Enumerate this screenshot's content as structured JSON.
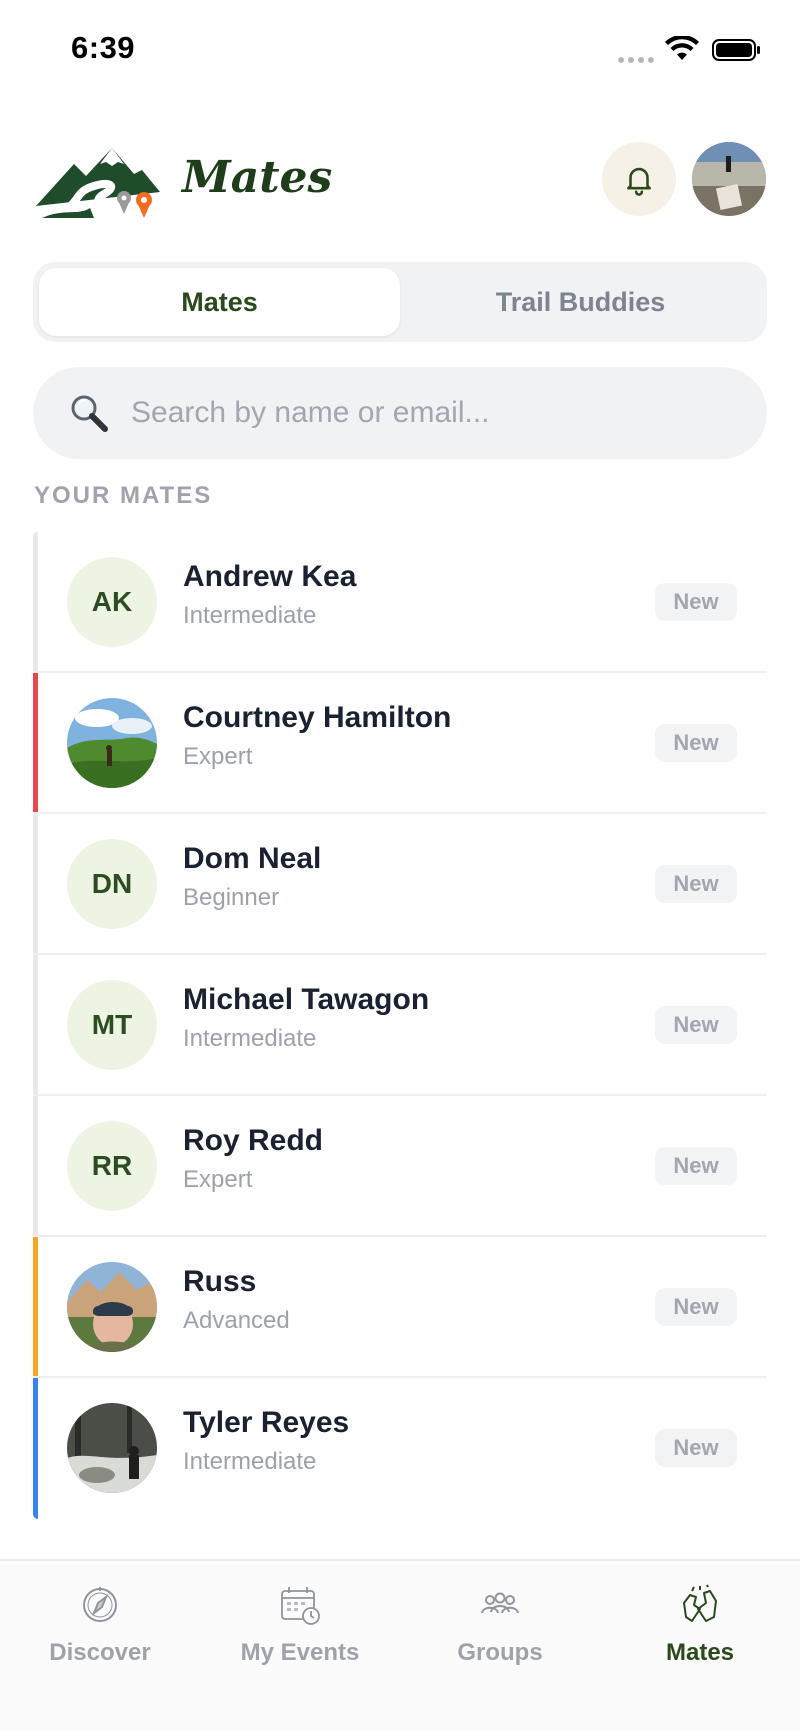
{
  "status_bar": {
    "time": "6:39"
  },
  "header": {
    "title": "Mates"
  },
  "tabs": [
    {
      "label": "Mates",
      "active": true
    },
    {
      "label": "Trail Buddies",
      "active": false
    }
  ],
  "search": {
    "placeholder": "Search by name or email..."
  },
  "section_title": "YOUR MATES",
  "mates": [
    {
      "initials": "AK",
      "name": "Andrew Kea",
      "level": "Intermediate",
      "badge": "New",
      "accent": "#e8e8e8",
      "photo": false
    },
    {
      "initials": "",
      "name": "Courtney Hamilton",
      "level": "Expert",
      "badge": "New",
      "accent": "#e5484d",
      "photo": true
    },
    {
      "initials": "DN",
      "name": "Dom Neal",
      "level": "Beginner",
      "badge": "New",
      "accent": "#e8e8e8",
      "photo": false
    },
    {
      "initials": "MT",
      "name": "Michael Tawagon",
      "level": "Intermediate",
      "badge": "New",
      "accent": "#e8e8e8",
      "photo": false
    },
    {
      "initials": "RR",
      "name": "Roy Redd",
      "level": "Expert",
      "badge": "New",
      "accent": "#e8e8e8",
      "photo": false
    },
    {
      "initials": "",
      "name": "Russ",
      "level": "Advanced",
      "badge": "New",
      "accent": "#f5a623",
      "photo": true
    },
    {
      "initials": "",
      "name": "Tyler Reyes",
      "level": "Intermediate",
      "badge": "New",
      "accent": "#3b82f6",
      "photo": true
    }
  ],
  "bottom_nav": [
    {
      "label": "Discover",
      "icon": "compass-icon",
      "active": false
    },
    {
      "label": "My Events",
      "icon": "calendar-icon",
      "active": false
    },
    {
      "label": "Groups",
      "icon": "group-icon",
      "active": false
    },
    {
      "label": "Mates",
      "icon": "high-five-icon",
      "active": true
    }
  ],
  "colors": {
    "brand_green": "#2a4a1c",
    "accent_red": "#e5484d",
    "accent_orange": "#f5a623",
    "accent_blue": "#3b82f6"
  }
}
